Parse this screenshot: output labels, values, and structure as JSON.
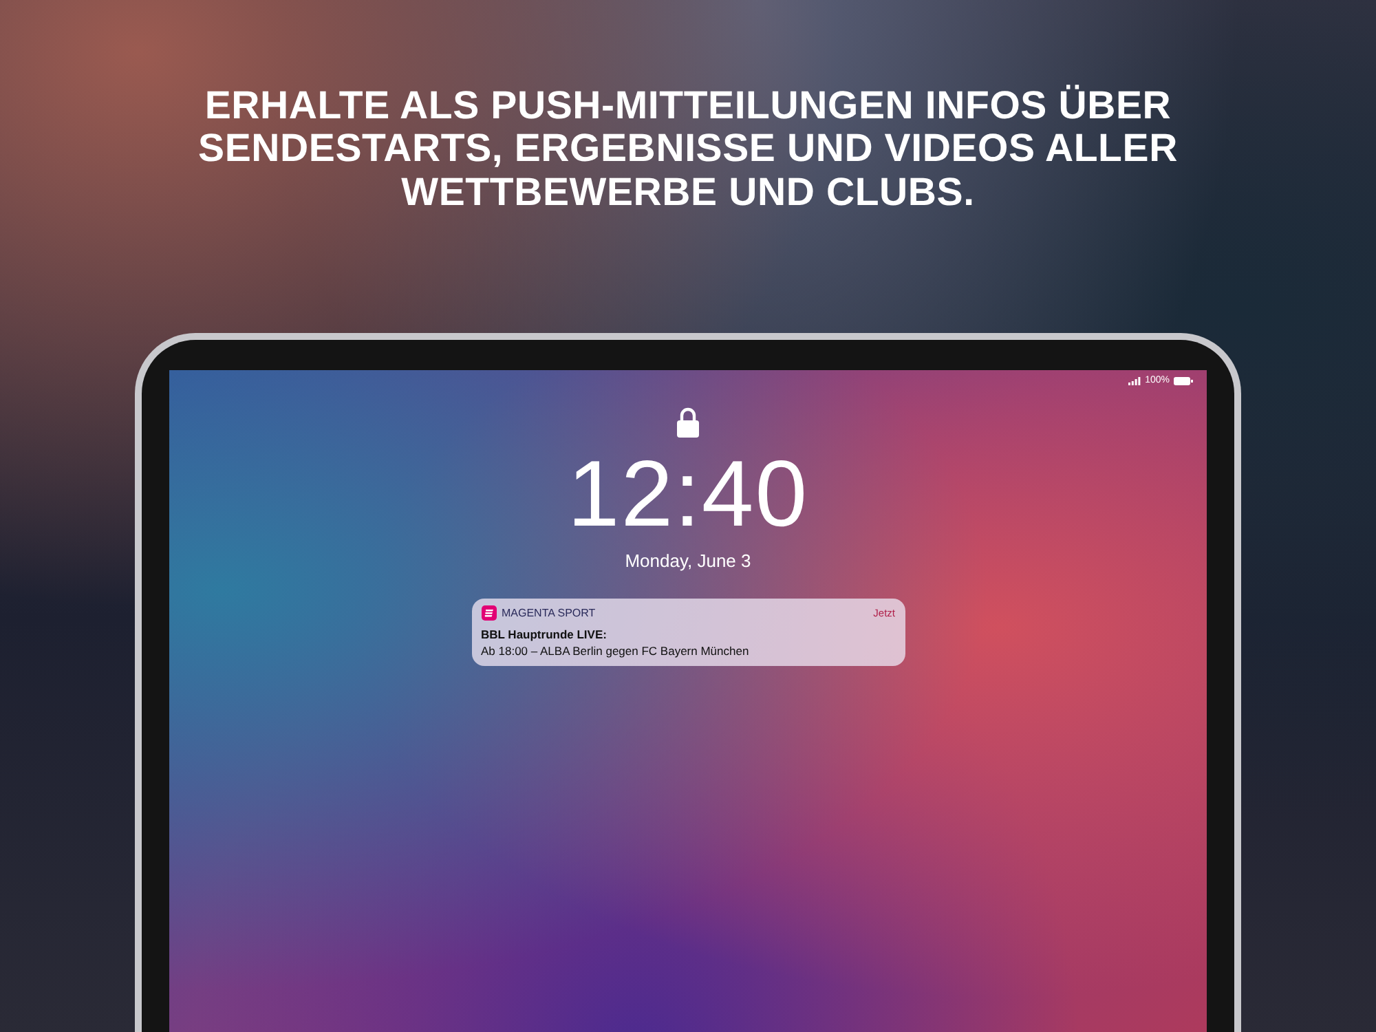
{
  "headline": "ERHALTE ALS PUSH-MITTEILUNGEN INFOS ÜBER SENDESTARTS, ERGEBNISSE UND VIDEOS ALLER WETTBEWERBE UND CLUBS.",
  "status_bar": {
    "battery_text": "100%"
  },
  "lock_screen": {
    "time": "12:40",
    "date": "Monday, June 3"
  },
  "notification": {
    "app_name": "MAGENTA SPORT",
    "time": "Jetzt",
    "title": "BBL Hauptrunde LIVE:",
    "body": "Ab 18:00 – ALBA Berlin gegen FC Bayern München"
  }
}
